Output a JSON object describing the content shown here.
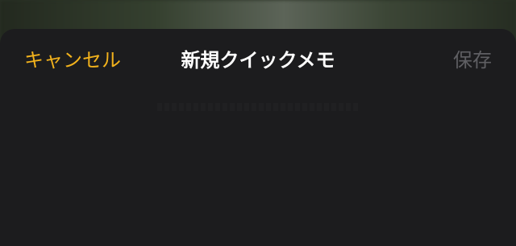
{
  "header": {
    "cancel_label": "キャンセル",
    "title": "新規クイックメモ",
    "save_label": "保存"
  },
  "colors": {
    "accent": "#f2b21c",
    "sheet_background": "#1c1c1e",
    "disabled_text": "#5f5f63",
    "title_text": "#ffffff"
  },
  "editor": {
    "value": "",
    "placeholder": ""
  }
}
